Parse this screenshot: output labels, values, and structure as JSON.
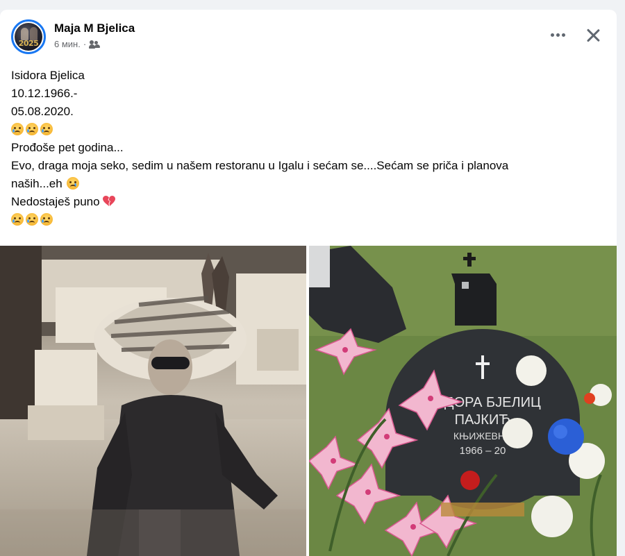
{
  "post": {
    "author": "Maja M Bjelica",
    "time": "6 мин.",
    "separator": "·",
    "audience_icon": "friends-icon",
    "avatar_text": "2025",
    "lines": [
      "Isidora Bjelica",
      "10.12.1966.-",
      "05.08.2020.",
      "Prođoše pet godina...",
      "Evo, draga moja seko, sedim u našem restoranu u Igalu i sećam se....Sećam se priča i planova",
      "naših...eh",
      "Nedostaješ puno"
    ],
    "emoji": {
      "crying_face": "crying-face-emoji",
      "sleepy_face": "sleepy-face-emoji",
      "broken_heart": "broken-heart-emoji"
    }
  },
  "header": {
    "more_icon": "more-horizontal-icon",
    "close_icon": "close-icon"
  },
  "photos": {
    "left_desc_icon": "photo-woman-hat",
    "right_desc_icon": "photo-grave-flowers",
    "grave_text": [
      "СИДОРА БЈЕЛИЦ",
      "ПАЈКИЋ",
      "КЊИЖЕВНИ",
      "1966 – 20"
    ]
  },
  "colors": {
    "accent": "#1877f2",
    "text": "#050505",
    "secondary": "#65676b",
    "background": "#f0f2f5"
  }
}
